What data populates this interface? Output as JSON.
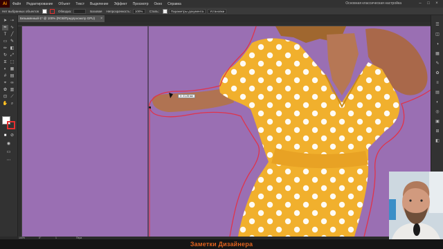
{
  "menubar": {
    "app_logo": "Ai",
    "items": [
      "Файл",
      "Редактирование",
      "Объект",
      "Текст",
      "Выделение",
      "Эффект",
      "Просмотр",
      "Окно",
      "Справка"
    ],
    "workspace": "Основная классическая настройка"
  },
  "control_bar": {
    "selection_label": "Нет выбранных объектов",
    "stroke_label": "Обводка:",
    "style_label": "Базовая",
    "opacity_label": "Непрозрачность:",
    "opacity_value": "100%",
    "style2_label": "Стиль:",
    "doc_settings_label": "Параметры документа",
    "preferences_label": "Установки"
  },
  "document_tab": {
    "title": "Безымянный-1* @ 100% (RGB/Предпросмотр GPU)",
    "close_icon": "close-icon"
  },
  "canvas": {
    "background_color": "#9a6fb3",
    "outline_color": "#e0334a",
    "dress_color": "#f1b02d",
    "tooltip_text": "Х: 21,28 мм"
  },
  "status_bar": {
    "zoom": "100%",
    "rotation": "0°",
    "artboard": "1",
    "tool": "Пера"
  },
  "caption": {
    "text": "Заметки Дизайнера",
    "color": "#e0631f"
  }
}
